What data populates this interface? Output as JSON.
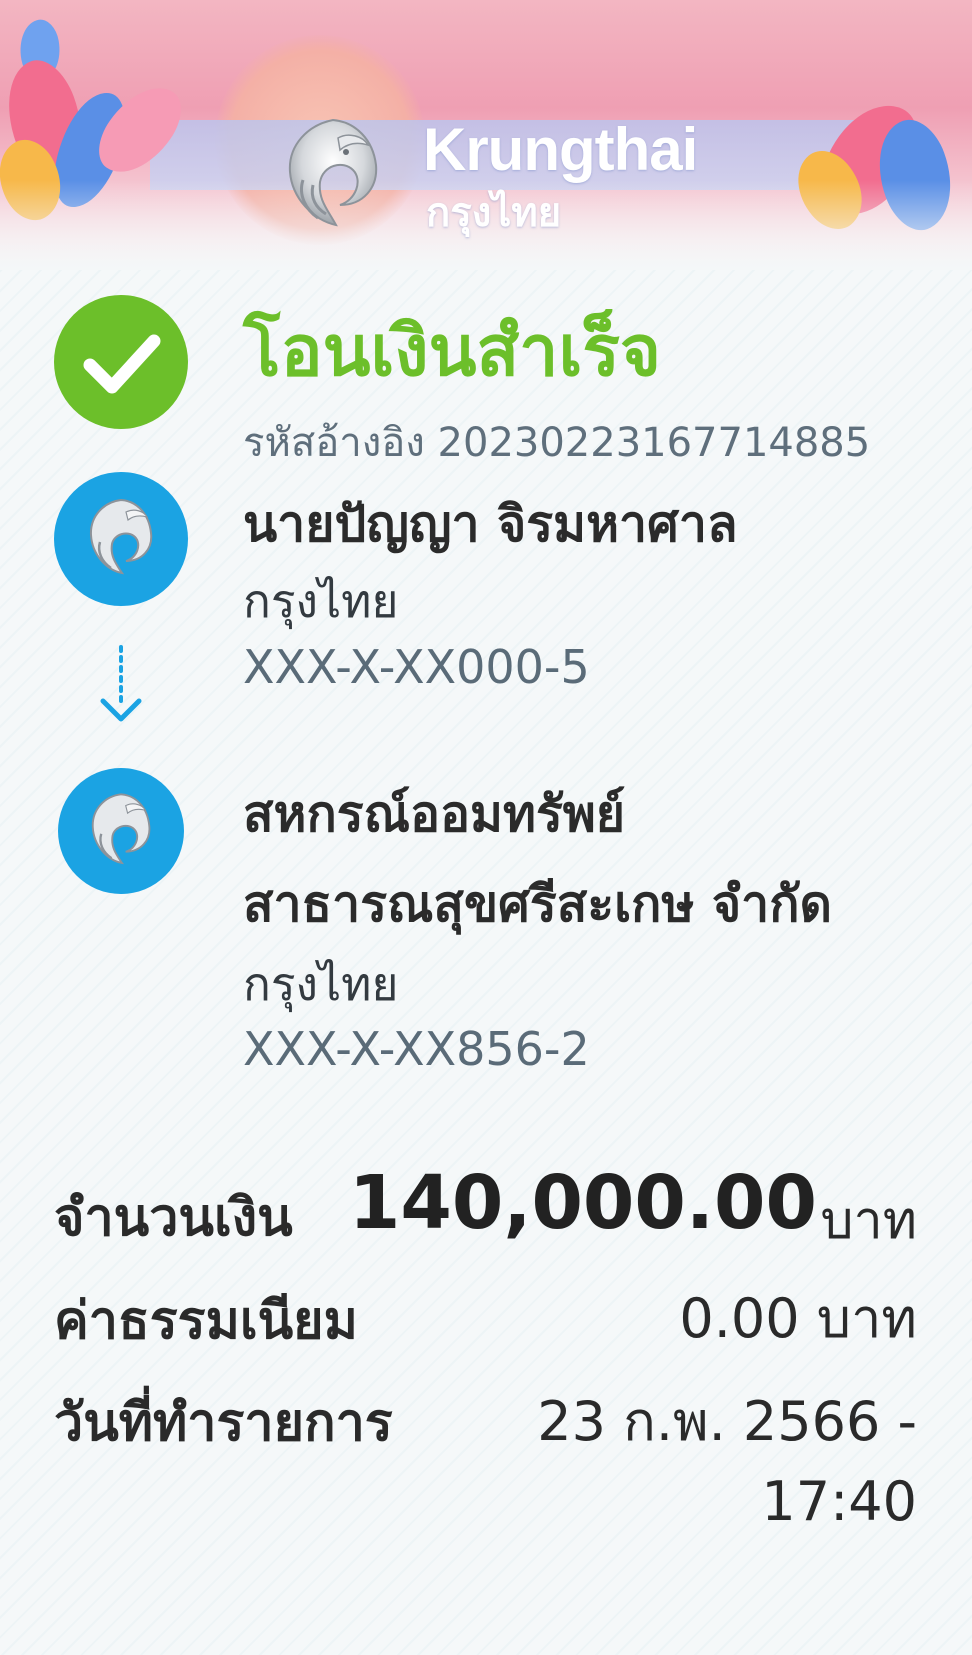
{
  "brand": {
    "name_en": "Krungthai",
    "name_th": "กรุงไทย"
  },
  "status": {
    "title": "โอนเงินสำเร็จ",
    "reference": "รหัสอ้างอิง 20230223167714885",
    "color": "#6cbf2a",
    "icon": "check-icon"
  },
  "sender": {
    "name": "นายปัญญา จิรมหาศาล",
    "bank": "กรุงไทย",
    "account": "XXX-X-XX000-5"
  },
  "receiver": {
    "name_line1": "สหกรณ์ออมทรัพย์",
    "name_line2": "สาธารณสุขศรีสะเกษ จำกัด",
    "bank": "กรุงไทย",
    "account": "XXX-X-XX856-2"
  },
  "details": {
    "amount_label": "จำนวนเงิน",
    "amount_value": "140,000.00",
    "amount_unit": "บาท",
    "fee_label": "ค่าธรรมเนียม",
    "fee_value": "0.00 บาท",
    "date_label": "วันที่ทำรายการ",
    "date_value": "23 ก.พ. 2566 -",
    "time_value": "17:40"
  },
  "colors": {
    "bank_blue": "#1ba3e3",
    "success_green": "#6cbf2a"
  }
}
